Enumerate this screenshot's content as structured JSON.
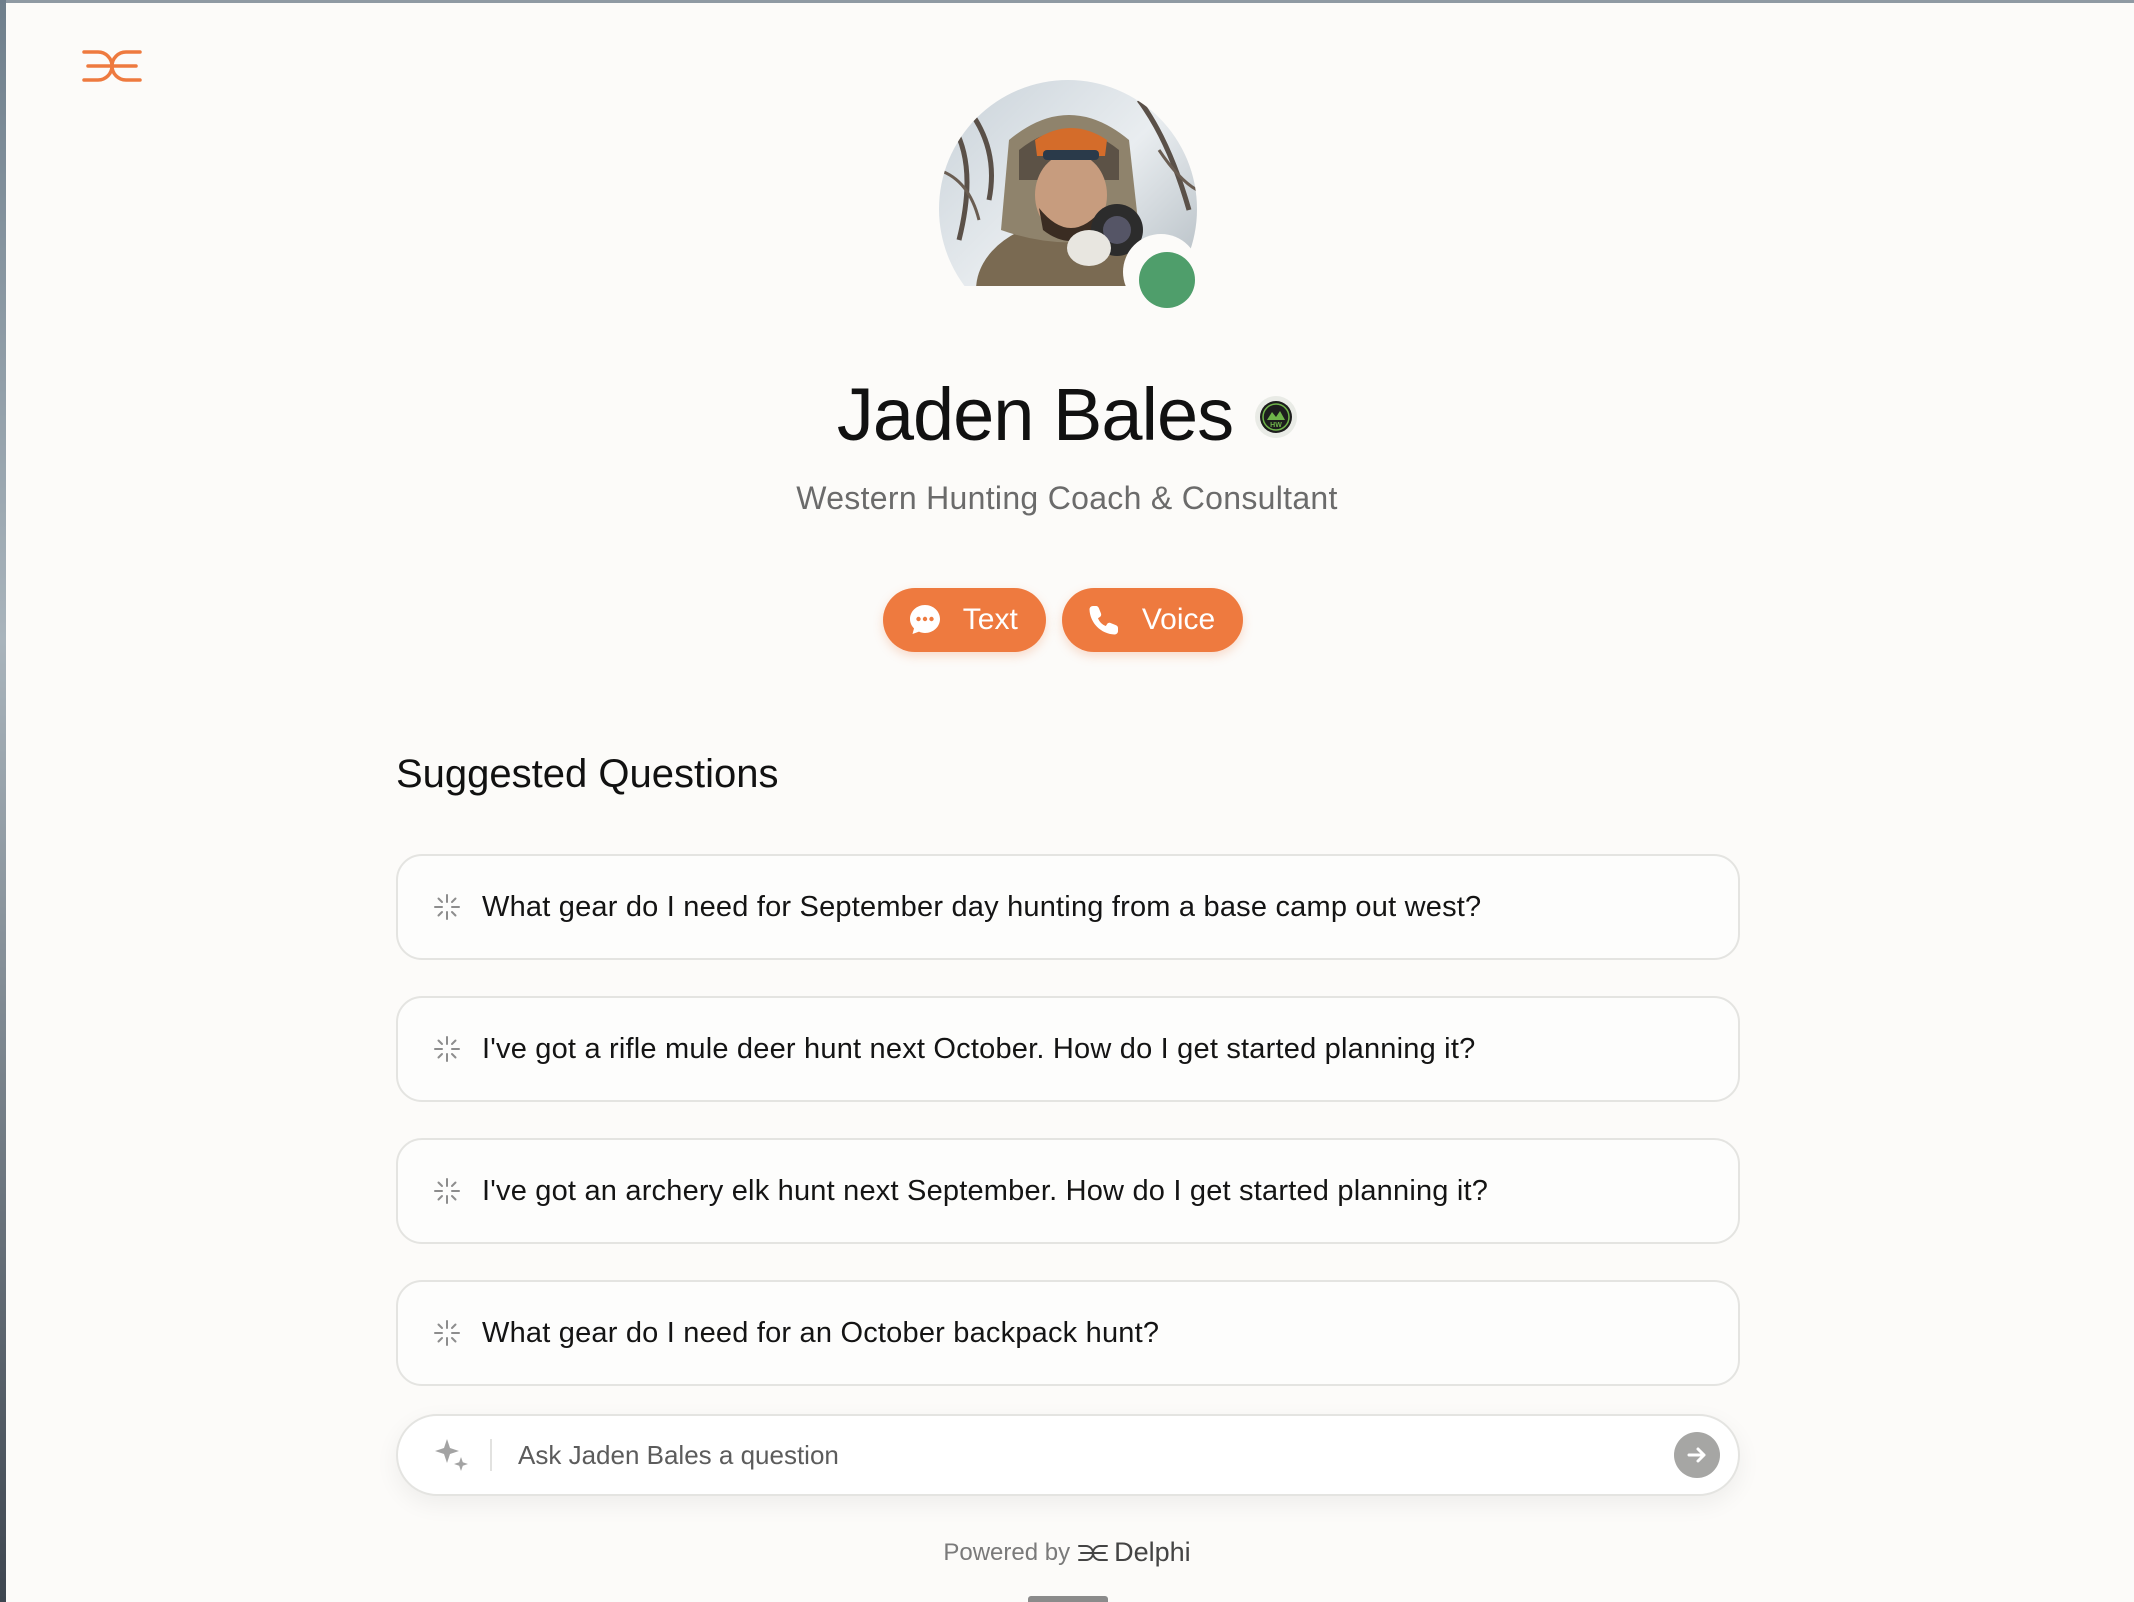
{
  "brand": {
    "accent": "#ee7a3f",
    "logo_icon": "delphi-logo-icon"
  },
  "profile": {
    "name": "Jaden Bales",
    "subtitle": "Western Hunting Coach & Consultant",
    "status_color": "#4f9e6b",
    "badge_icon": "hunting-badge-icon"
  },
  "actions": {
    "text_label": "Text",
    "voice_label": "Voice"
  },
  "suggested": {
    "title": "Suggested Questions",
    "questions": [
      "What gear do I need for September day hunting from a base camp out west?",
      "I've got a rifle mule deer hunt next October. How do I get started planning it?",
      "I've got an archery elk hunt next September. How do I get started planning it?",
      "What gear do I need for an October backpack hunt?"
    ]
  },
  "ask": {
    "placeholder": "Ask Jaden Bales a question",
    "value": ""
  },
  "footer": {
    "powered_by": "Powered by",
    "brand_name": "Delphi"
  }
}
